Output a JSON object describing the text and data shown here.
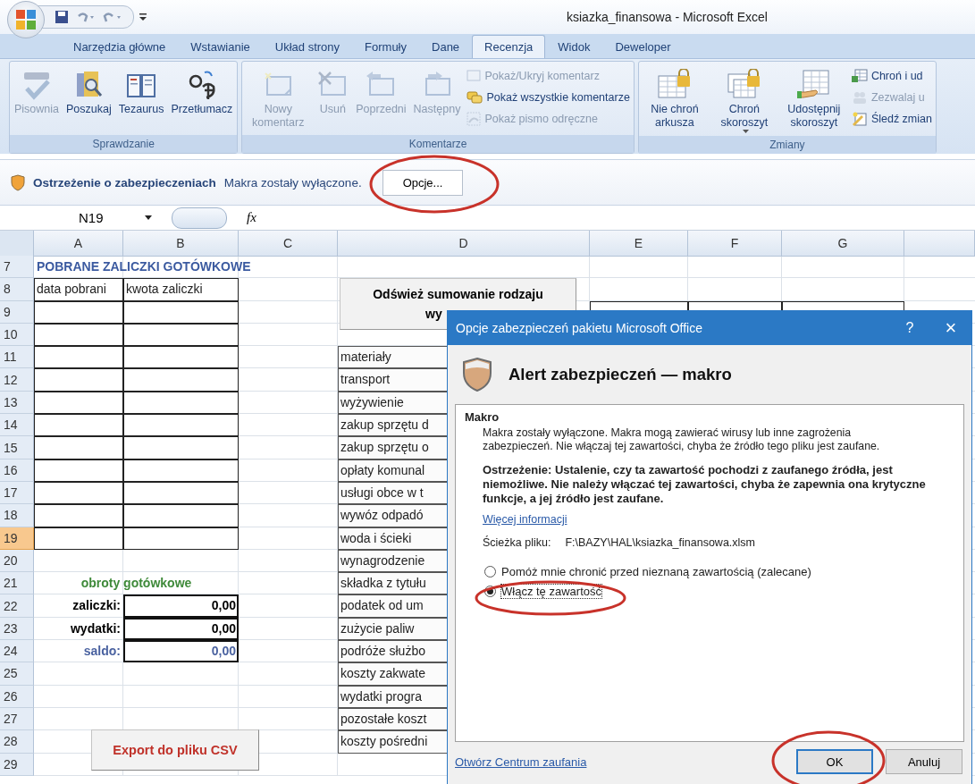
{
  "window": {
    "title": "ksiazka_finansowa - Microsoft Excel"
  },
  "ribbon_tabs": [
    {
      "label": "Narzędzia główne",
      "selected": false
    },
    {
      "label": "Wstawianie",
      "selected": false
    },
    {
      "label": "Układ strony",
      "selected": false
    },
    {
      "label": "Formuły",
      "selected": false
    },
    {
      "label": "Dane",
      "selected": false
    },
    {
      "label": "Recenzja",
      "selected": true
    },
    {
      "label": "Widok",
      "selected": false
    },
    {
      "label": "Deweloper",
      "selected": false
    }
  ],
  "ribbon_groups": [
    {
      "title": "Sprawdzanie",
      "large_buttons": [
        {
          "label": "Pisownia",
          "disabled": true,
          "kind": "plain"
        },
        {
          "label": "Poszukaj",
          "disabled": false,
          "kind": "plain"
        },
        {
          "label": "Tezaurus",
          "disabled": false,
          "kind": "plain"
        },
        {
          "label": "Przetłumacz",
          "disabled": false,
          "kind": "plain"
        }
      ]
    },
    {
      "title": "Komentarze",
      "large_buttons": [
        {
          "label": "Nowy komentarz",
          "disabled": true,
          "kind": "plain"
        },
        {
          "label": "Usuń",
          "disabled": true,
          "kind": "plain"
        },
        {
          "label": "Poprzedni",
          "disabled": true,
          "kind": "plain"
        },
        {
          "label": "Następny",
          "disabled": true,
          "kind": "plain"
        }
      ],
      "small_buttons": [
        {
          "label": "Pokaż/Ukryj komentarz",
          "disabled": true
        },
        {
          "label": "Pokaż wszystkie komentarze",
          "disabled": false
        },
        {
          "label": "Pokaż pismo odręczne",
          "disabled": true
        }
      ]
    },
    {
      "title": "Zmiany",
      "large_buttons": [
        {
          "label": "Nie chroń arkusza",
          "disabled": false,
          "kind": "plain"
        },
        {
          "label": "Chroń skoroszyt",
          "disabled": false,
          "kind": "dropdown"
        },
        {
          "label": "Udostępnij skoroszyt",
          "disabled": false,
          "kind": "plain"
        }
      ],
      "small_buttons": [
        {
          "label": "Chroń i ud",
          "disabled": false
        },
        {
          "label": "Zezwalaj u",
          "disabled": true
        },
        {
          "label": "Śledź zmian",
          "disabled": false
        }
      ]
    }
  ],
  "security_bar": {
    "title": "Ostrzeżenie o zabezpieczeniach",
    "message": "Makra zostały wyłączone.",
    "button": "Opcje..."
  },
  "formula_bar": {
    "name_box": "N19",
    "function_label": "fx"
  },
  "sheet": {
    "columns": [
      {
        "label": "A"
      },
      {
        "label": "B"
      },
      {
        "label": "C"
      },
      {
        "label": "D"
      },
      {
        "label": "E"
      },
      {
        "label": "F"
      },
      {
        "label": "G"
      },
      {}
    ],
    "rows": [
      {
        "number": "7",
        "selected": false,
        "cells": [
          {
            "kind": "title",
            "text": "POBRANE ZALICZKI GOTÓWKOWE"
          }
        ]
      },
      {
        "number": "8",
        "selected": false,
        "cells": [
          {
            "kind": "boxed",
            "text": "data pobrani"
          },
          {
            "kind": "boxed",
            "text": "kwota zaliczki"
          }
        ]
      },
      {
        "number": "9",
        "selected": false,
        "cells": [
          {
            "kind": "boxed"
          },
          {
            "kind": "boxed"
          },
          {
            "kind": "blank"
          },
          {
            "kind": "blank"
          },
          {
            "kind": "boxed"
          },
          {
            "kind": "boxed"
          },
          {
            "kind": "boxed"
          }
        ]
      },
      {
        "number": "10",
        "selected": false,
        "cells": [
          {
            "kind": "boxed"
          },
          {
            "kind": "boxed"
          }
        ]
      },
      {
        "number": "11",
        "selected": false,
        "cells": [
          {
            "kind": "boxed"
          },
          {
            "kind": "boxed"
          },
          {
            "kind": "blank"
          },
          {
            "kind": "category",
            "text": "materiały"
          }
        ]
      },
      {
        "number": "12",
        "selected": false,
        "cells": [
          {
            "kind": "boxed"
          },
          {
            "kind": "boxed"
          },
          {
            "kind": "blank"
          },
          {
            "kind": "category",
            "text": "transport"
          }
        ]
      },
      {
        "number": "13",
        "selected": false,
        "cells": [
          {
            "kind": "boxed"
          },
          {
            "kind": "boxed"
          },
          {
            "kind": "blank"
          },
          {
            "kind": "category",
            "text": "wyżywienie"
          }
        ]
      },
      {
        "number": "14",
        "selected": false,
        "cells": [
          {
            "kind": "boxed"
          },
          {
            "kind": "boxed"
          },
          {
            "kind": "blank"
          },
          {
            "kind": "category",
            "text": "zakup sprzętu d"
          }
        ]
      },
      {
        "number": "15",
        "selected": false,
        "cells": [
          {
            "kind": "boxed"
          },
          {
            "kind": "boxed"
          },
          {
            "kind": "blank"
          },
          {
            "kind": "category",
            "text": "zakup sprzętu o"
          }
        ]
      },
      {
        "number": "16",
        "selected": false,
        "cells": [
          {
            "kind": "boxed"
          },
          {
            "kind": "boxed"
          },
          {
            "kind": "blank"
          },
          {
            "kind": "category",
            "text": "opłaty komunal"
          }
        ]
      },
      {
        "number": "17",
        "selected": false,
        "cells": [
          {
            "kind": "boxed"
          },
          {
            "kind": "boxed"
          },
          {
            "kind": "blank"
          },
          {
            "kind": "category",
            "text": "usługi obce w t"
          }
        ]
      },
      {
        "number": "18",
        "selected": false,
        "cells": [
          {
            "kind": "boxed"
          },
          {
            "kind": "boxed"
          },
          {
            "kind": "blank"
          },
          {
            "kind": "category",
            "text": "wywóz odpadó"
          }
        ]
      },
      {
        "number": "19",
        "selected": true,
        "cells": [
          {
            "kind": "boxed"
          },
          {
            "kind": "boxed"
          },
          {
            "kind": "blank"
          },
          {
            "kind": "category",
            "text": "woda i ścieki"
          }
        ]
      },
      {
        "number": "20",
        "selected": false,
        "cells": [
          {
            "kind": "blank"
          },
          {
            "kind": "blank"
          },
          {
            "kind": "blank"
          },
          {
            "kind": "category",
            "text": "wynagrodzenie"
          }
        ]
      },
      {
        "number": "21",
        "selected": false,
        "cells": [
          {
            "kind": "section",
            "text": "obroty gotówkowe"
          },
          {
            "kind": "blank"
          },
          {
            "kind": "category",
            "text": "składka z tytułu"
          }
        ]
      },
      {
        "number": "22",
        "selected": false,
        "cells": [
          {
            "kind": "label",
            "text": "zaliczki:",
            "color": "#000000"
          },
          {
            "kind": "total",
            "text": "0,00",
            "color": "#000000"
          },
          {
            "kind": "blank"
          },
          {
            "kind": "category",
            "text": "podatek od um"
          }
        ]
      },
      {
        "number": "23",
        "selected": false,
        "cells": [
          {
            "kind": "label",
            "text": "wydatki:",
            "color": "#000000"
          },
          {
            "kind": "total",
            "text": "0,00",
            "color": "#000000"
          },
          {
            "kind": "blank"
          },
          {
            "kind": "category",
            "text": "zużycie paliw"
          }
        ]
      },
      {
        "number": "24",
        "selected": false,
        "cells": [
          {
            "kind": "label",
            "text": "saldo:",
            "color": "#4a62a0"
          },
          {
            "kind": "total",
            "text": "0,00",
            "color": "#4a62a0"
          },
          {
            "kind": "blank"
          },
          {
            "kind": "category",
            "text": "podróże służbo"
          }
        ]
      },
      {
        "number": "25",
        "selected": false,
        "cells": [
          {
            "kind": "blank"
          },
          {
            "kind": "blank"
          },
          {
            "kind": "blank"
          },
          {
            "kind": "category",
            "text": "koszty zakwate"
          }
        ]
      },
      {
        "number": "26",
        "selected": false,
        "cells": [
          {
            "kind": "blank"
          },
          {
            "kind": "blank"
          },
          {
            "kind": "blank"
          },
          {
            "kind": "category",
            "text": "wydatki progra"
          }
        ]
      },
      {
        "number": "27",
        "selected": false,
        "cells": [
          {
            "kind": "blank"
          },
          {
            "kind": "blank"
          },
          {
            "kind": "blank"
          },
          {
            "kind": "category",
            "text": "pozostałe koszt"
          }
        ]
      },
      {
        "number": "28",
        "selected": false,
        "cells": [
          {
            "kind": "blank"
          },
          {
            "kind": "blank"
          },
          {
            "kind": "blank"
          },
          {
            "kind": "category",
            "text": "koszty pośredni"
          }
        ]
      },
      {
        "number": "29",
        "selected": false
      }
    ],
    "refresh_button": {
      "lines": [
        "Odśwież sumowanie rodzaju",
        "wy"
      ]
    },
    "export_button": {
      "label": "Export do pliku CSV"
    }
  },
  "dialog": {
    "title": "Opcje zabezpieczeń pakietu Microsoft Office",
    "help": "?",
    "close": "×",
    "heading": "Alert zabezpieczeń — makro",
    "section": "Makro",
    "description": "Makra zostały wyłączone. Makra mogą zawierać wirusy lub inne zagrożenia zabezpieczeń. Nie włączaj tej zawartości, chyba że źródło tego pliku jest zaufane.",
    "warning": "Ostrzeżenie: Ustalenie, czy ta zawartość pochodzi z zaufanego źródła, jest niemożliwe. Nie należy włączać tej zawartości, chyba że zapewnia ona krytyczne funkcje, a jej źródło jest zaufane.",
    "more_link": "Więcej informacji",
    "path_label": "Ścieżka pliku:",
    "path": "F:\\BAZY\\HAL\\ksiazka_finansowa.xlsm",
    "options": [
      {
        "label": "Pomóż mnie chronić przed nieznaną zawartością (zalecane)",
        "selected": false
      },
      {
        "label": "Włącz tę zawartość",
        "selected": true
      }
    ],
    "trust_center_link": "Otwórz Centrum zaufania",
    "buttons": [
      {
        "label": "OK",
        "kind": "default"
      },
      {
        "label": "Anuluj",
        "kind": "normal"
      }
    ]
  }
}
